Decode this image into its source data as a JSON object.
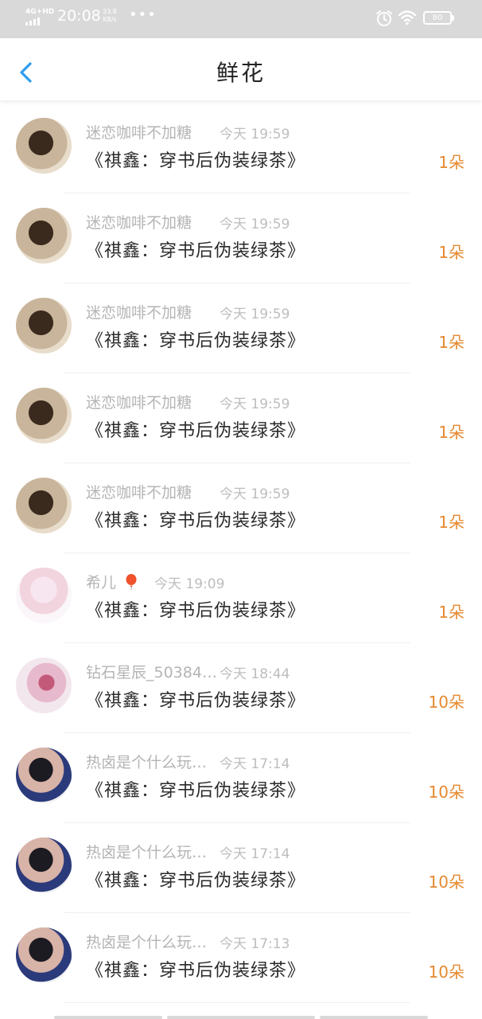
{
  "status_bar": {
    "network": "4G+HD",
    "time": "20:08",
    "speed_value": "33.8",
    "speed_unit": "KB/s",
    "dots": "•••",
    "battery": "80"
  },
  "header": {
    "title": "鲜花"
  },
  "list": [
    {
      "name": "迷恋咖啡不加糖",
      "time": "今天 19:59",
      "book": "《祺鑫：穿书后伪装绿茶》",
      "count": "1朵",
      "avatar": "av-brown"
    },
    {
      "name": "迷恋咖啡不加糖",
      "time": "今天 19:59",
      "book": "《祺鑫：穿书后伪装绿茶》",
      "count": "1朵",
      "avatar": "av-brown"
    },
    {
      "name": "迷恋咖啡不加糖",
      "time": "今天 19:59",
      "book": "《祺鑫：穿书后伪装绿茶》",
      "count": "1朵",
      "avatar": "av-brown"
    },
    {
      "name": "迷恋咖啡不加糖",
      "time": "今天 19:59",
      "book": "《祺鑫：穿书后伪装绿茶》",
      "count": "1朵",
      "avatar": "av-brown"
    },
    {
      "name": "迷恋咖啡不加糖",
      "time": "今天 19:59",
      "book": "《祺鑫：穿书后伪装绿茶》",
      "count": "1朵",
      "avatar": "av-brown"
    },
    {
      "name": "希儿",
      "time": "今天 19:09",
      "book": "《祺鑫：穿书后伪装绿茶》",
      "count": "1朵",
      "avatar": "av-anime",
      "balloon": true
    },
    {
      "name": "钻石星辰_50384…",
      "time": "今天 18:44",
      "book": "《祺鑫：穿书后伪装绿茶》",
      "count": "10朵",
      "avatar": "av-anime2"
    },
    {
      "name": "热卤是个什么玩…",
      "time": "今天 17:14",
      "book": "《祺鑫：穿书后伪装绿茶》",
      "count": "10朵",
      "avatar": "av-boy"
    },
    {
      "name": "热卤是个什么玩…",
      "time": "今天 17:14",
      "book": "《祺鑫：穿书后伪装绿茶》",
      "count": "10朵",
      "avatar": "av-boy"
    },
    {
      "name": "热卤是个什么玩…",
      "time": "今天 17:13",
      "book": "《祺鑫：穿书后伪装绿茶》",
      "count": "10朵",
      "avatar": "av-boy"
    }
  ],
  "colors": {
    "accent_back": "#2e9df0",
    "count_orange": "#e6892f",
    "status_bar_bg": "#d9d9d9"
  }
}
